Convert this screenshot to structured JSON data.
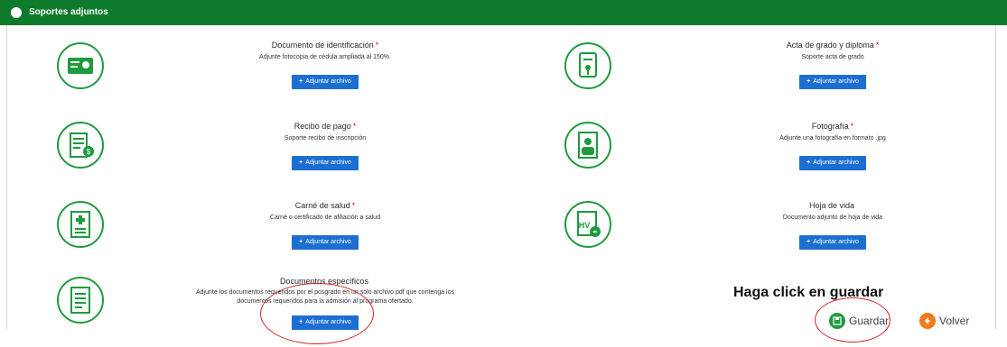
{
  "header": {
    "title": "Soportes adjuntos"
  },
  "documents": [
    {
      "title": "Documento de identificación",
      "required": "*",
      "description": "Adjunte fotocopia de cédula ampliada al 150%.",
      "button": "Adjuntar archivo",
      "icon": "id-card-icon"
    },
    {
      "title": "Acta de grado y diploma",
      "required": "*",
      "description": "Soporte acta de grado",
      "button": "Adjuntar archivo",
      "icon": "diploma-icon"
    },
    {
      "title": "Recibo de pago",
      "required": "*",
      "description": "Soporte recibo de inscripción",
      "button": "Adjuntar archivo",
      "icon": "receipt-icon"
    },
    {
      "title": "Fotografía",
      "required": "*",
      "description": "Adjunte una fotografía en formato .jpg",
      "button": "Adjuntar archivo",
      "icon": "photo-icon"
    },
    {
      "title": "Carné de salud",
      "required": "*",
      "description": "Carné o certificado de afiliación a salud",
      "button": "Adjuntar archivo",
      "icon": "health-card-icon"
    },
    {
      "title": "Hoja de vida",
      "required": "",
      "description": "Documento adjunto de hoja de vida",
      "button": "Adjuntar archivo",
      "icon": "resume-icon"
    },
    {
      "title": "Documentos específicos",
      "required": "",
      "description": "Adjunte los documentos requeridos por el posgrado en un solo archivo pdf que contenga los documentos requeridos para la admisión al programa ofertado.",
      "button": "Adjuntar archivo",
      "icon": "document-icon"
    }
  ],
  "callout": "Haga click en guardar",
  "actions": {
    "save": "Guardar",
    "back": "Volver"
  },
  "colors": {
    "header": "#0e7a2c",
    "icon_green": "#1f9a3e",
    "button": "#1c6fd1",
    "required": "#d01c1c",
    "annotation": "#d42222",
    "back": "#f07a1a"
  }
}
